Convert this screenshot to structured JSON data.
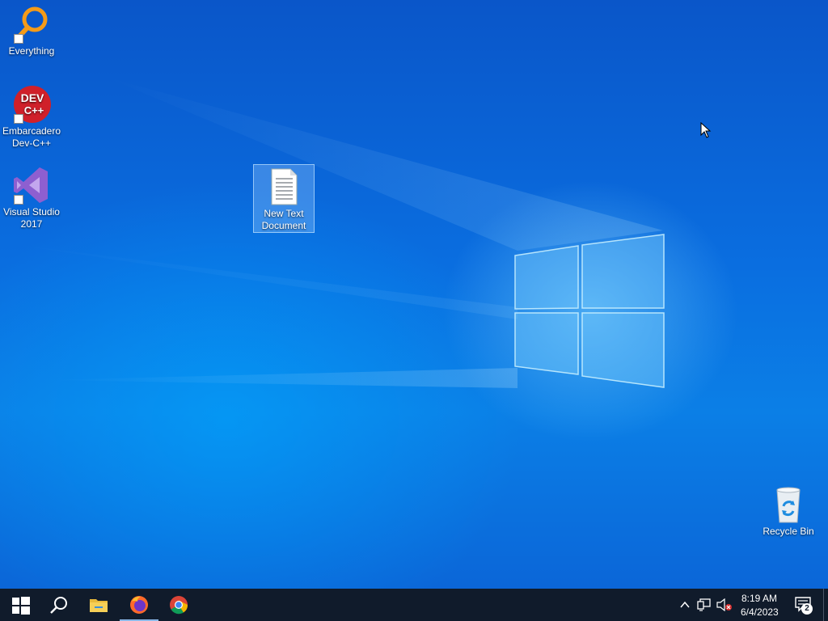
{
  "desktop": {
    "icons": [
      {
        "label": "Everything"
      },
      {
        "label": "Embarcadero Dev-C++"
      },
      {
        "label": "Visual Studio 2017"
      },
      {
        "label": "New Text Document"
      },
      {
        "label": "Recycle Bin"
      }
    ]
  },
  "taskbar": {
    "start_icon": "windows-logo-icon",
    "search_icon": "search-icon",
    "pinned": [
      {
        "icon": "file-explorer-icon"
      },
      {
        "icon": "firefox-icon"
      },
      {
        "icon": "chrome-icon"
      }
    ],
    "tray": {
      "time": "8:19 AM",
      "date": "6/4/2023",
      "notification_count": "2"
    }
  },
  "colors": {
    "taskbar": "#101b2b",
    "desktop_blue": "#0a6ee0",
    "accent": "#8ab8e8"
  }
}
